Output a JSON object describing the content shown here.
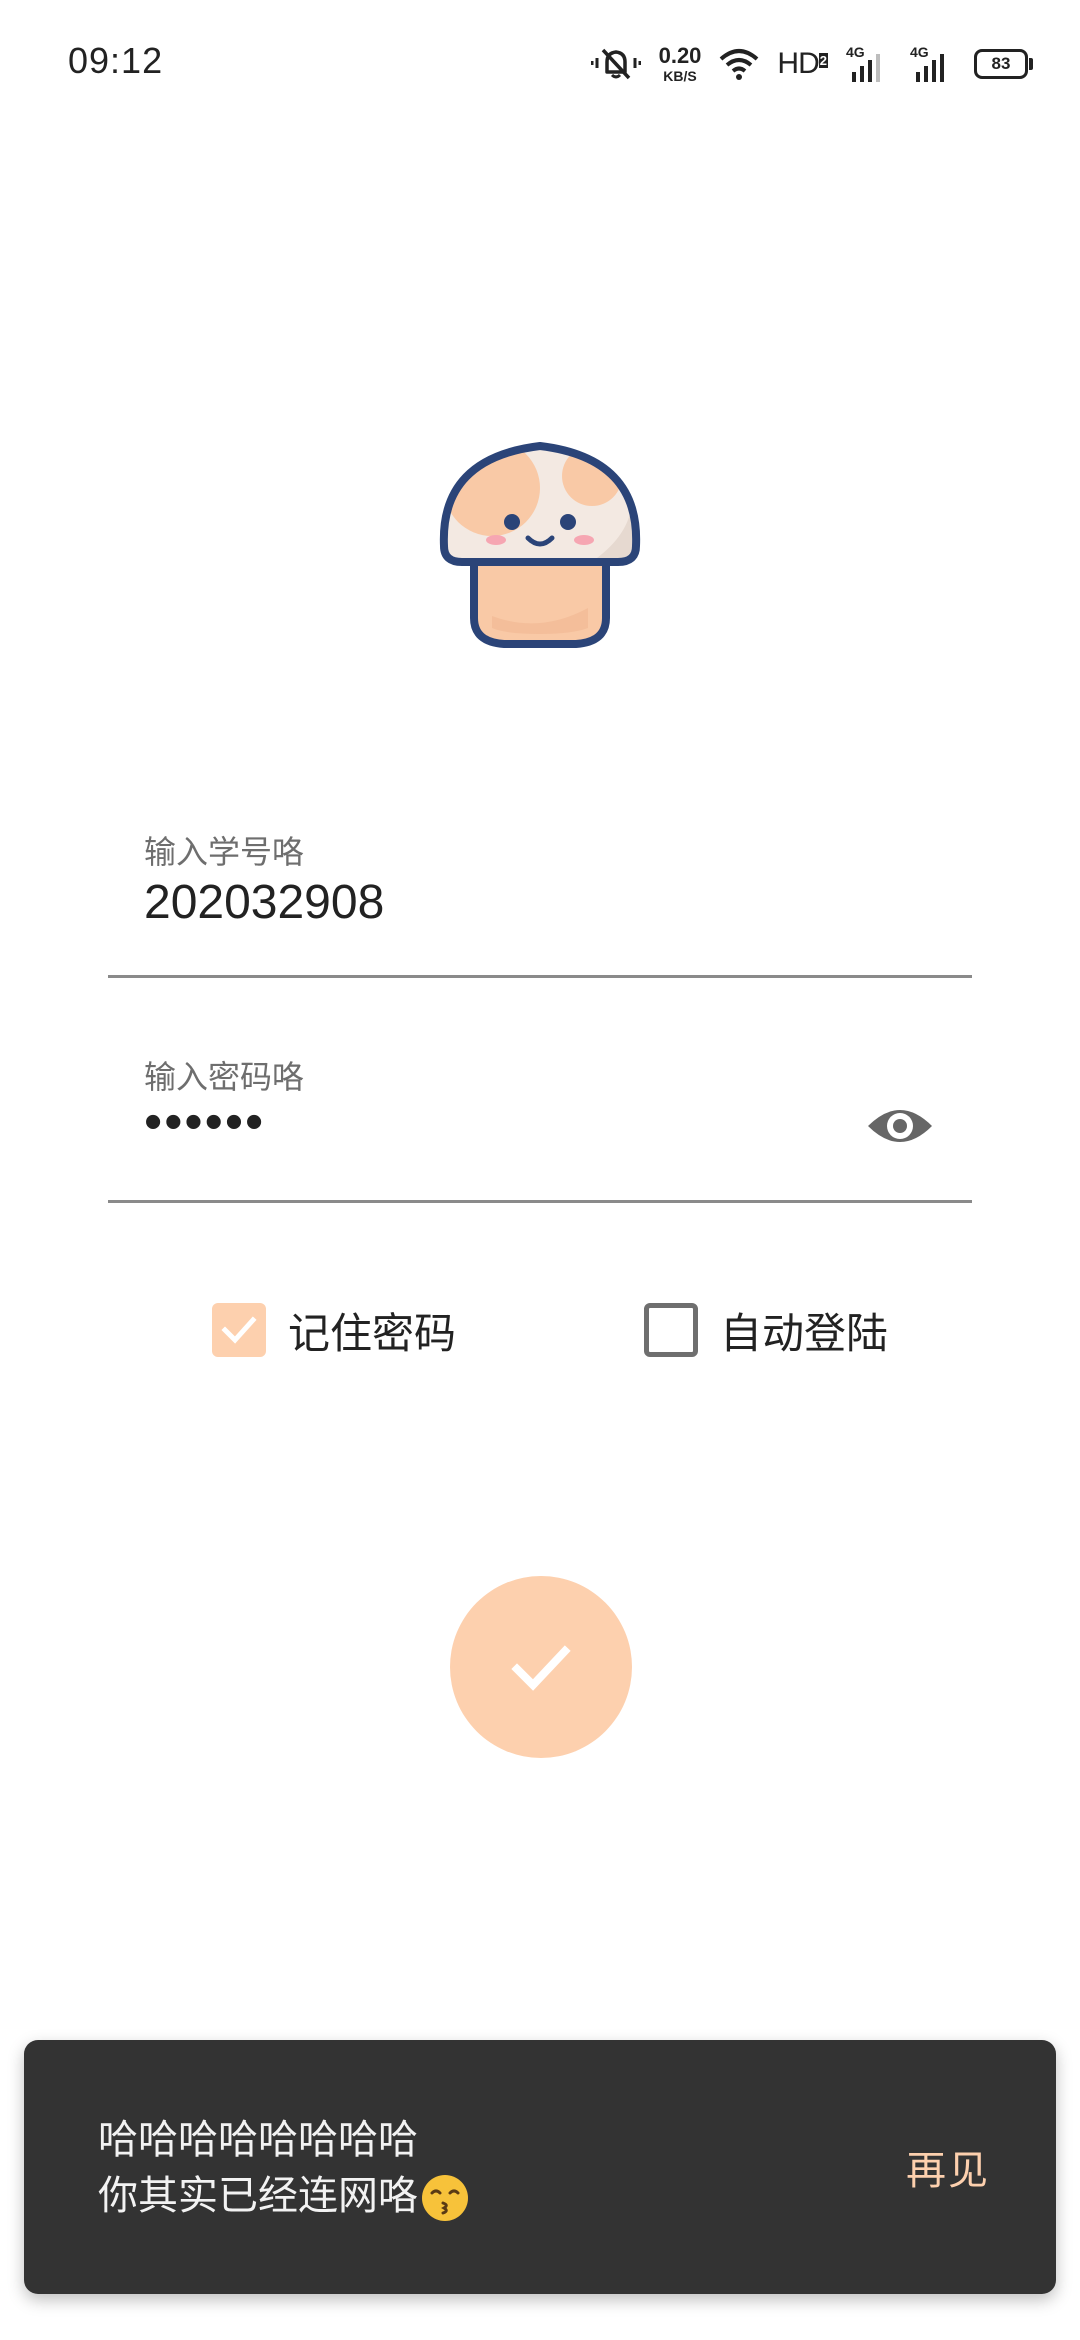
{
  "status_bar": {
    "time": "09:12",
    "net_speed_value": "0.20",
    "net_speed_unit": "KB/S",
    "hd": "HD",
    "hd_sub": "2",
    "sim1": "4G",
    "sim2": "4G",
    "battery": "83"
  },
  "login": {
    "student_id_label": "输入学号咯",
    "student_id_value": "202032908",
    "password_label": "输入密码咯",
    "password_value": "••••••",
    "remember_label": "记住密码",
    "remember_checked": true,
    "autologin_label": "自动登陆",
    "autologin_checked": false
  },
  "snackbar": {
    "line1": "哈哈哈哈哈哈哈哈",
    "line2": "你其实已经连网咯",
    "emoji": "kissing-face",
    "action": "再见"
  },
  "colors": {
    "accent": "#fdd0ae",
    "snackbar_bg": "#333333",
    "logo_outline": "#2b4478"
  },
  "icons": {
    "eye": "eye-icon",
    "submit": "check-icon"
  }
}
